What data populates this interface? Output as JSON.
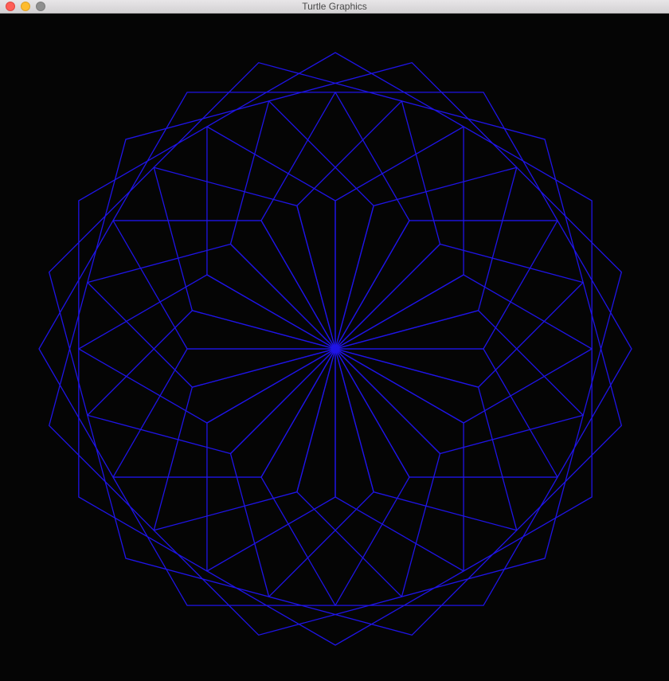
{
  "window": {
    "title": "Turtle Graphics"
  },
  "titlebar": {
    "close_icon": "close-icon",
    "minimize_icon": "minimize-icon",
    "zoom_icon": "zoom-icon"
  },
  "canvas": {
    "background_color": "#050505",
    "pen_color": "#1f14e6"
  }
}
